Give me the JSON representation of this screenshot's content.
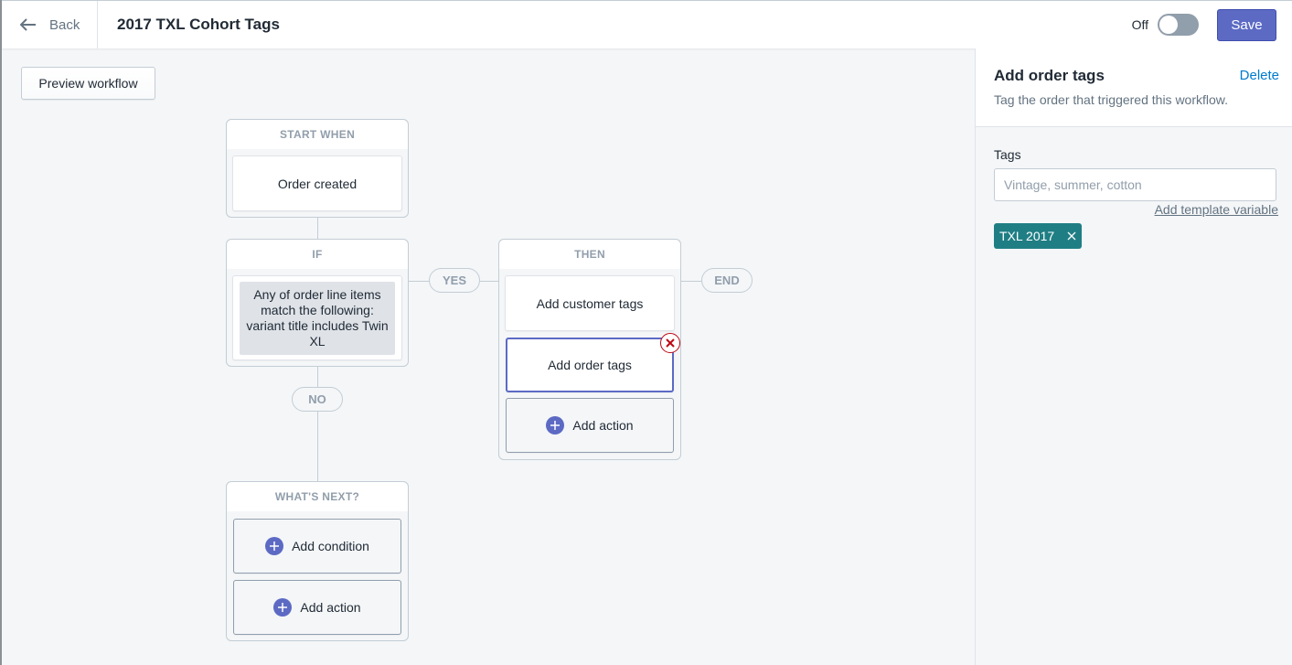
{
  "header": {
    "back_label": "Back",
    "title": "2017 TXL Cohort Tags",
    "toggle_label": "Off",
    "toggle_on": false,
    "save_label": "Save"
  },
  "canvas": {
    "preview_label": "Preview workflow",
    "start": {
      "heading": "START WHEN",
      "trigger": "Order created"
    },
    "condition": {
      "heading": "IF",
      "text": "Any of order line items match the following: variant title includes Twin XL"
    },
    "yes_label": "YES",
    "no_label": "NO",
    "end_label": "END",
    "then": {
      "heading": "THEN",
      "actions": [
        "Add customer tags",
        "Add order tags"
      ],
      "add_action_label": "Add action"
    },
    "next": {
      "heading": "WHAT'S NEXT?",
      "add_condition_label": "Add condition",
      "add_action_label": "Add action"
    }
  },
  "panel": {
    "title": "Add order tags",
    "delete_label": "Delete",
    "description": "Tag the order that triggered this workflow.",
    "tags_label": "Tags",
    "tags_placeholder": "Vintage, summer, cotton",
    "tags_value": "",
    "template_link": "Add template variable",
    "tags": [
      "TXL 2017"
    ]
  },
  "colors": {
    "accent": "#5c6ac4",
    "tag_chip": "#1f7e84",
    "link": "#007ace",
    "danger": "#bf0711"
  }
}
